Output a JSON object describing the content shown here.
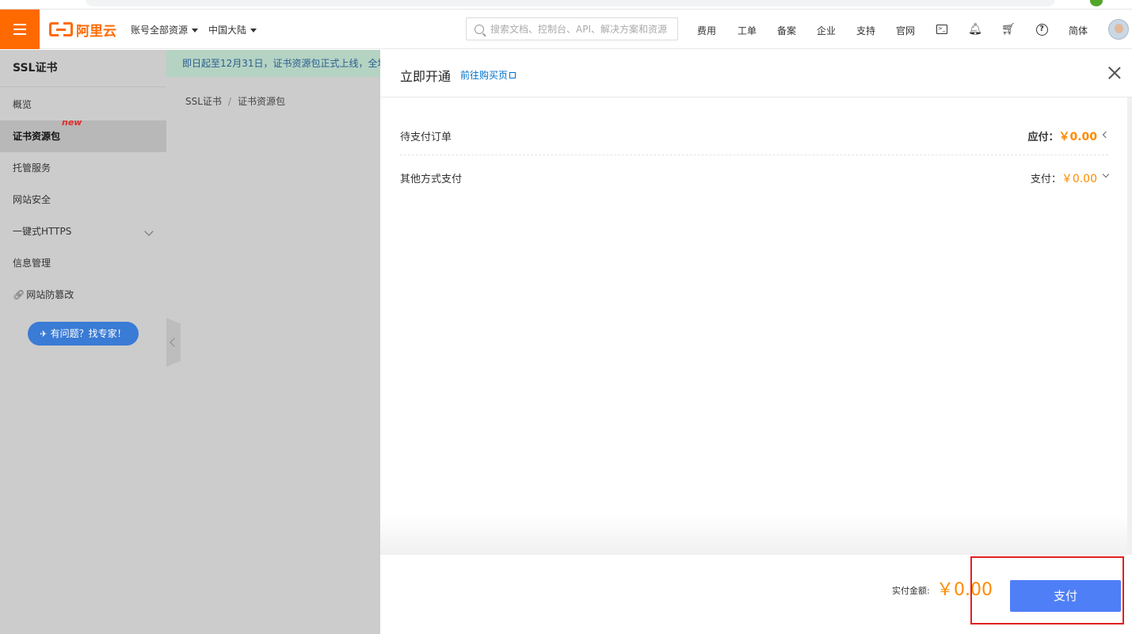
{
  "topbar": {
    "logo_text": "阿里云",
    "account_dropdown": "账号全部资源",
    "region_dropdown": "中国大陆",
    "search_placeholder": "搜索文档、控制台、API、解决方案和资源",
    "links": [
      "费用",
      "工单",
      "备案",
      "企业",
      "支持",
      "官网"
    ],
    "language": "简体",
    "icons": [
      "terminal-icon",
      "bell-icon",
      "cart-icon",
      "help-icon"
    ]
  },
  "sidebar": {
    "title": "SSL证书",
    "items": [
      {
        "label": "概览"
      },
      {
        "label": "证书资源包",
        "badge": "new"
      },
      {
        "label": "托管服务"
      },
      {
        "label": "网站安全"
      },
      {
        "label": "一键式HTTPS"
      },
      {
        "label": "信息管理"
      },
      {
        "label": "网站防篡改"
      }
    ],
    "expert_button": "有问题？找专家！"
  },
  "main": {
    "notice": "即日起至12月31日，证书资源包正式上线，全场",
    "breadcrumb": [
      "SSL证书",
      "证书资源包"
    ],
    "breadcrumb_sep": "/"
  },
  "drawer": {
    "title": "立即开通",
    "buy_link": "前往购买页",
    "rows": [
      {
        "label": "待支付订单",
        "amount_label": "应付：",
        "amount": "￥0.00"
      },
      {
        "label": "其他方式支付",
        "amount_label": "支付：",
        "amount": "￥0.00"
      }
    ],
    "total_label": "实付金额:",
    "total_value": "￥0.00",
    "pay_button": "支付"
  },
  "colors": {
    "brand": "#ff6a00",
    "price": "#ff8a00",
    "pay_button": "#4f7ff7",
    "highlight": "#e02020"
  }
}
